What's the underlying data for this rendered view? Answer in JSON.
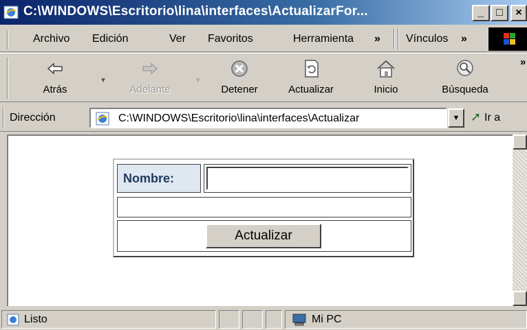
{
  "window": {
    "title": "C:\\WINDOWS\\Escritorio\\lina\\interfaces\\ActualizarFor...",
    "buttons": {
      "minimize": "_",
      "maximize": "□",
      "close": "×"
    }
  },
  "menu": {
    "items": [
      "Archivo",
      "Edición",
      "Ver",
      "Favoritos",
      "Herramienta"
    ],
    "more": "»",
    "links_label": "Vínculos",
    "links_more": "»"
  },
  "toolbar": {
    "back": "Atrás",
    "forward": "Adelante",
    "stop": "Detener",
    "refresh": "Actualizar",
    "home": "Inicio",
    "search": "Búsqueda",
    "more": "»"
  },
  "address": {
    "label": "Dirección",
    "value": "C:\\WINDOWS\\Escritorio\\lina\\interfaces\\Actualizar",
    "go": "Ir a"
  },
  "form": {
    "name_label": "Nombre:",
    "name_value": "",
    "submit_label": "Actualizar"
  },
  "status": {
    "text": "Listo",
    "zone": "Mi PC"
  }
}
